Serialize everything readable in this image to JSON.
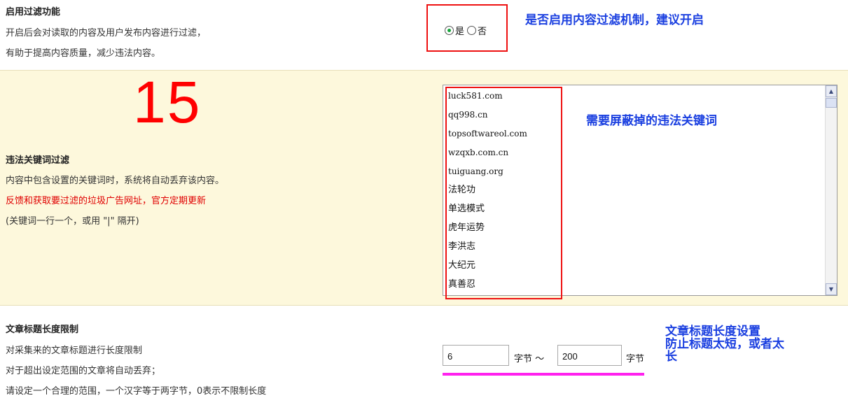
{
  "filter": {
    "title": "启用过滤功能",
    "desc_line1": "开启后会对读取的内容及用户发布内容进行过滤，",
    "desc_line2": "有助于提高内容质量，减少违法内容。",
    "option_yes": "是",
    "option_no": "否",
    "selected": "是",
    "annotation": "是否启用内容过滤机制，建议开启"
  },
  "keywords": {
    "big_number": "15",
    "title": "违法关键词过滤",
    "desc_line1": "内容中包含设置的关键词时，系统将自动丢弃该内容。",
    "desc_red": "反馈和获取要过滤的垃圾广告网址，官方定期更新",
    "desc_line3": "(关键词一行一个，或用 \"|\" 隔开)",
    "annotation": "需要屏蔽掉的违法关键词",
    "items": [
      "luck581.com",
      "qq998.cn",
      "topsoftwareol.com",
      "wzqxb.com.cn",
      "tuiguang.org",
      "法轮功",
      "单选模式",
      "虎年运势",
      "李洪志",
      "大纪元",
      "真善忍"
    ]
  },
  "title_length": {
    "title": "文章标题长度限制",
    "desc_line1": "对采集来的文章标题进行长度限制",
    "desc_line2": "对于超出设定范围的文章将自动丢弃；",
    "desc_line3": "请设定一个合理的范围，一个汉字等于两字节，0表示不限制长度",
    "min_value": "6",
    "unit1": "字节 ～",
    "max_value": "200",
    "unit2": "字节",
    "annotation_line1": "文章标题长度设置",
    "annotation_line2": "防止标题太短，或者太",
    "annotation_line3": "长"
  },
  "colors": {
    "annotation": "#1a3fe0",
    "highlight_box": "#ee1111",
    "big_number": "#ff0000",
    "underline": "#ff22ee",
    "row_highlight_bg": "#fdf8dc"
  },
  "icons": {
    "scroll_up": "scroll-up-icon",
    "scroll_down": "scroll-down-icon"
  }
}
